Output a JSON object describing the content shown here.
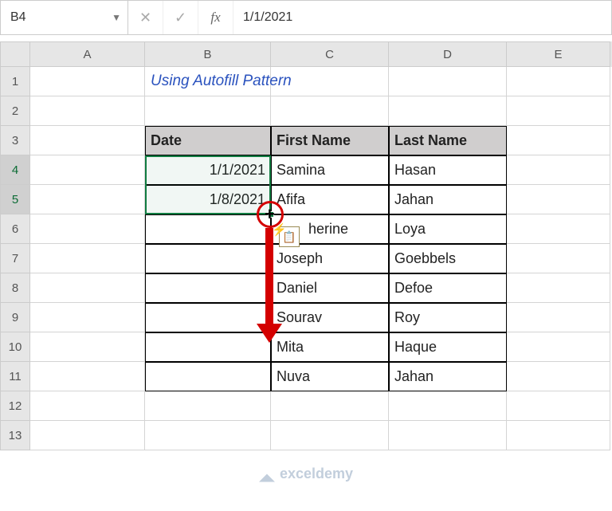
{
  "formula_bar": {
    "name_box": "B4",
    "cancel_glyph": "✕",
    "confirm_glyph": "✓",
    "fx_label": "fx",
    "value": "1/1/2021"
  },
  "columns": [
    "A",
    "B",
    "C",
    "D",
    "E"
  ],
  "rows": [
    "1",
    "2",
    "3",
    "4",
    "5",
    "6",
    "7",
    "8",
    "9",
    "10",
    "11",
    "12",
    "13"
  ],
  "title": "Using Autofill Pattern",
  "table": {
    "headers": {
      "date": "Date",
      "first": "First Name",
      "last": "Last Name"
    },
    "data": [
      {
        "date": "1/1/2021",
        "first": "Samina",
        "last": "Hasan"
      },
      {
        "date": "1/8/2021",
        "first": "Afifa",
        "last": "Jahan"
      },
      {
        "date": "",
        "first": "herine",
        "last": "Loya"
      },
      {
        "date": "",
        "first": "Joseph",
        "last": "Goebbels"
      },
      {
        "date": "",
        "first": "Daniel",
        "last": "Defoe"
      },
      {
        "date": "",
        "first": "Sourav",
        "last": "Roy"
      },
      {
        "date": "",
        "first": "Mita",
        "last": "Haque"
      },
      {
        "date": "",
        "first": "Nuva",
        "last": "Jahan"
      }
    ]
  },
  "smart_tag_glyph": "📋",
  "watermark": "exceldemy"
}
